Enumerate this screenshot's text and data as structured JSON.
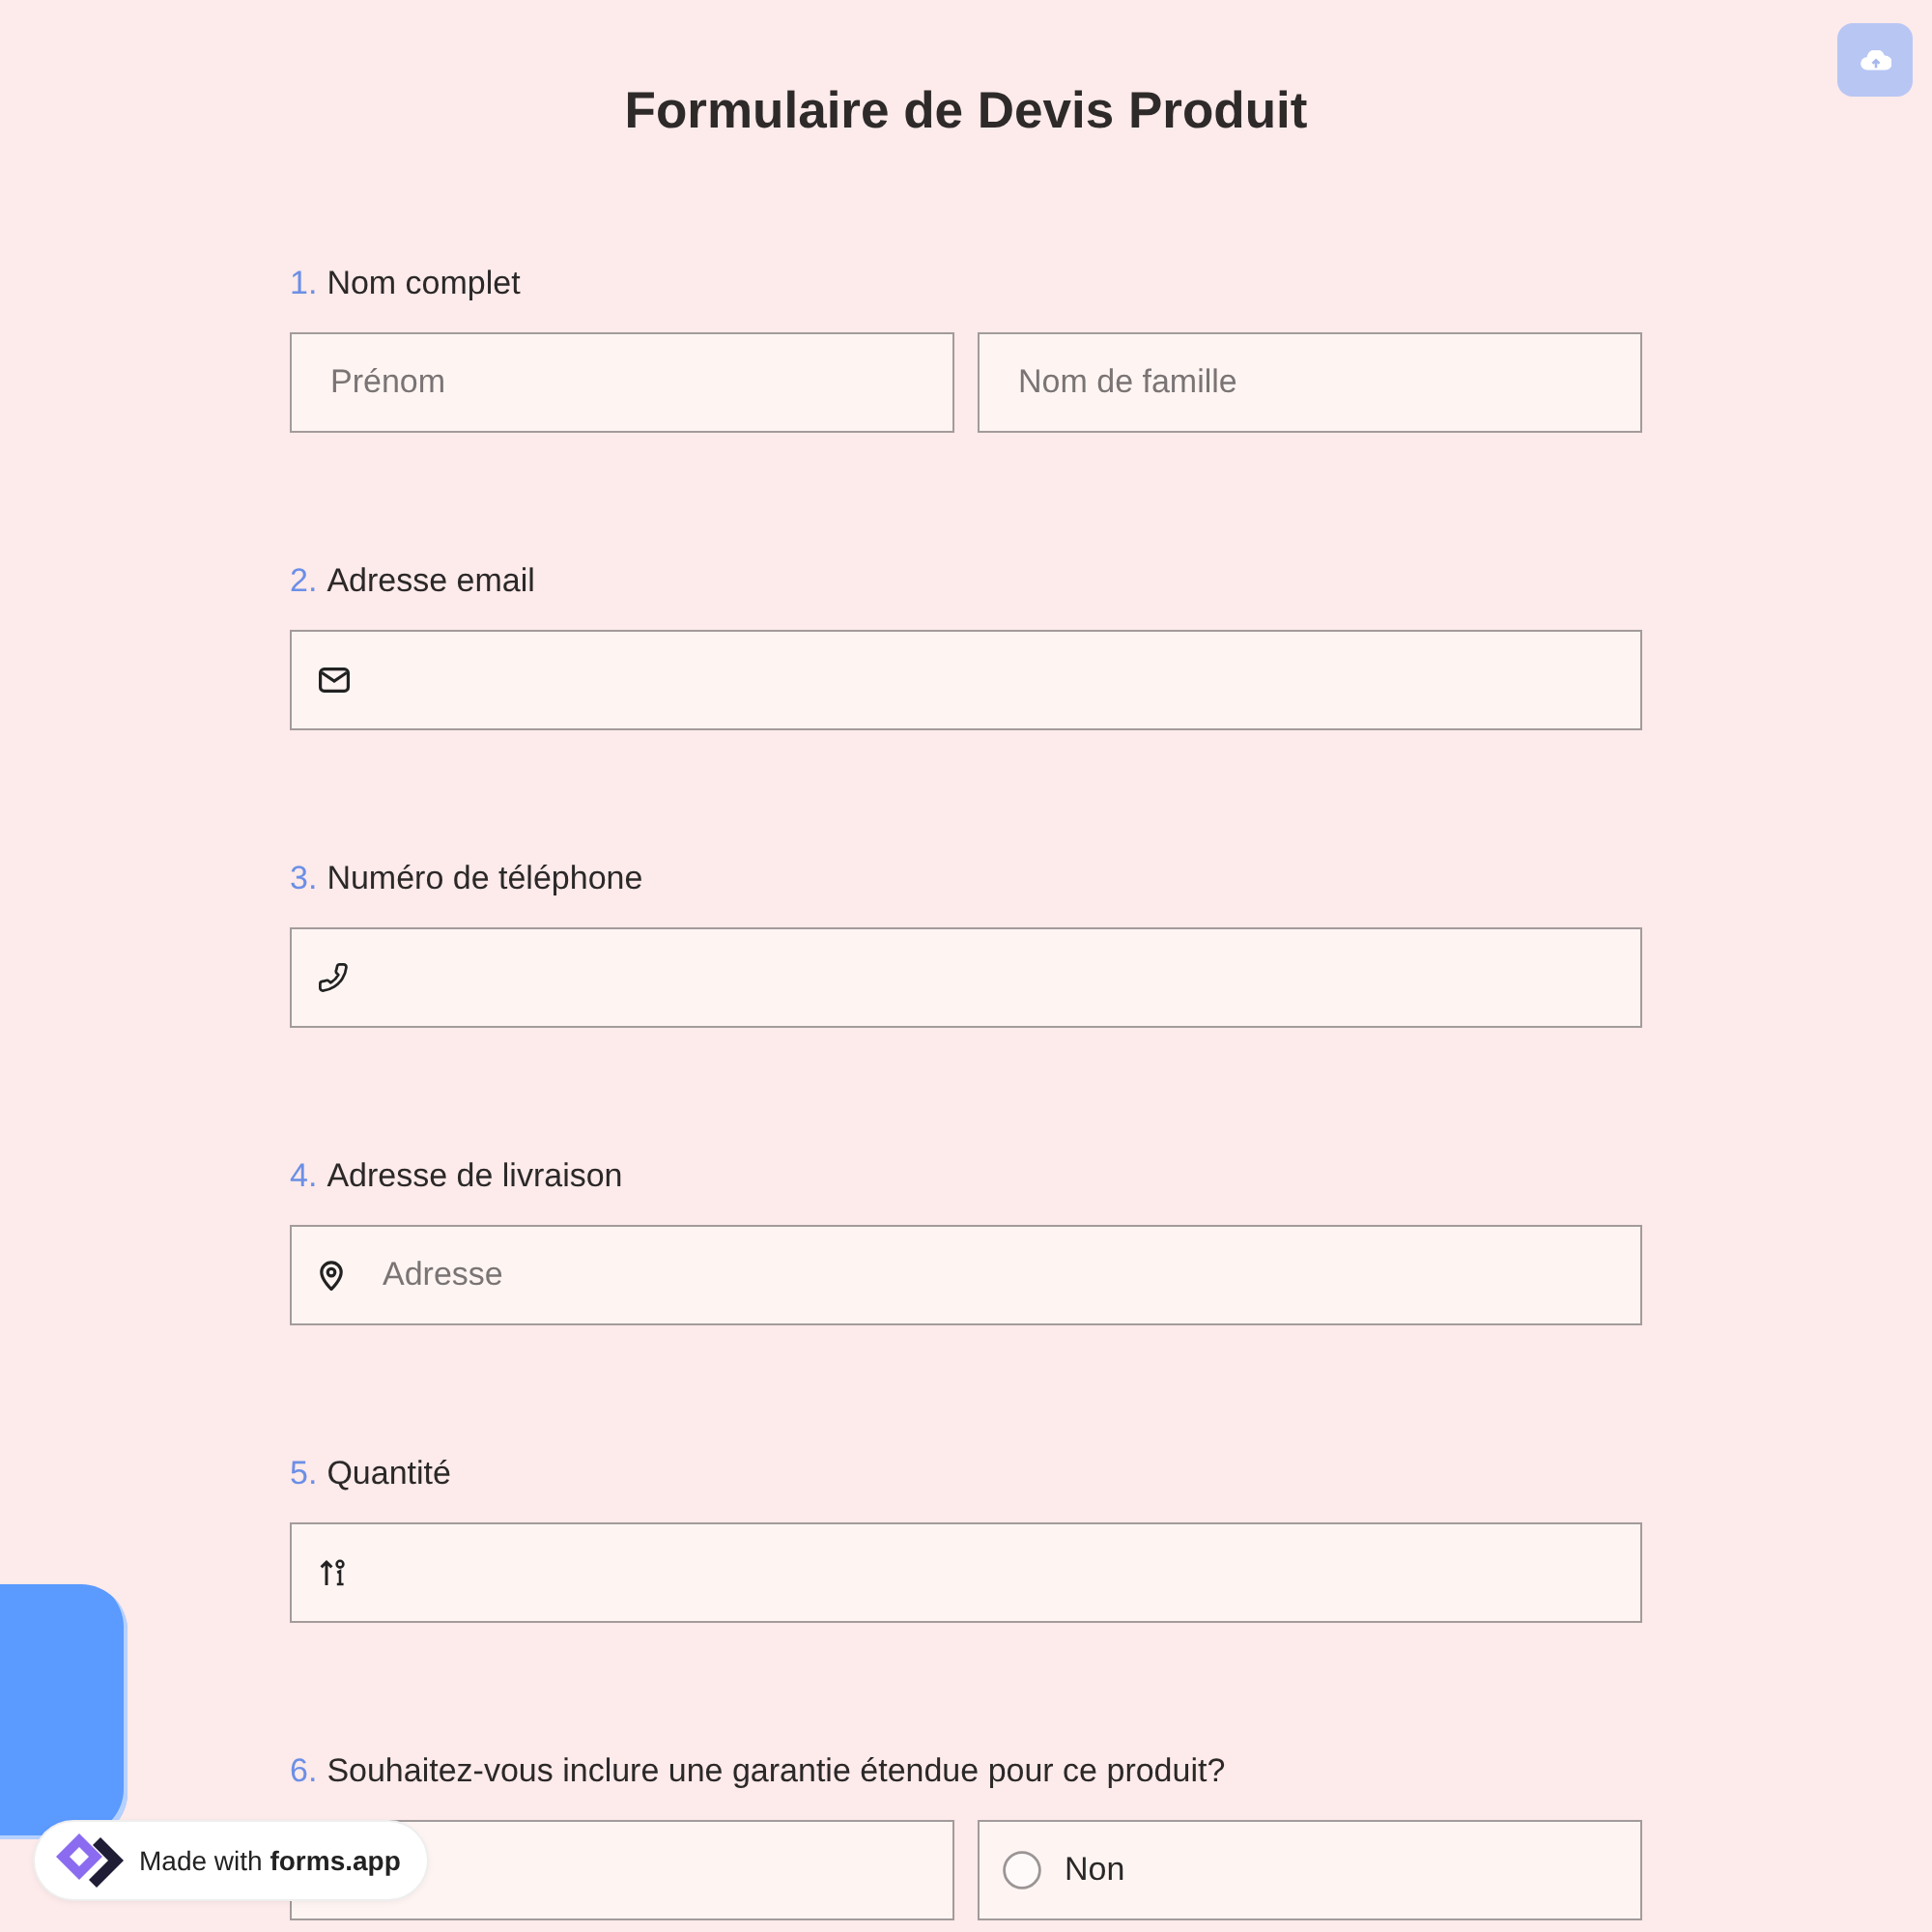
{
  "title": "Formulaire de Devis Produit",
  "questions": [
    {
      "number": "1.",
      "label": "Nom complet",
      "fields": [
        {
          "kind": "text",
          "placeholder": "Prénom"
        },
        {
          "kind": "text",
          "placeholder": "Nom de famille"
        }
      ]
    },
    {
      "number": "2.",
      "label": "Adresse email",
      "fields": [
        {
          "kind": "email"
        }
      ]
    },
    {
      "number": "3.",
      "label": "Numéro de téléphone",
      "fields": [
        {
          "kind": "phone"
        }
      ]
    },
    {
      "number": "4.",
      "label": "Adresse de livraison",
      "fields": [
        {
          "kind": "address",
          "placeholder": "Adresse"
        }
      ]
    },
    {
      "number": "5.",
      "label": "Quantité",
      "fields": [
        {
          "kind": "number"
        }
      ]
    },
    {
      "number": "6.",
      "label": "Souhaitez-vous inclure une garantie étendue pour ce produit?",
      "fields": [
        {
          "kind": "covered"
        },
        {
          "kind": "radio",
          "label": "Non",
          "selected": false
        }
      ]
    }
  ],
  "badge": {
    "text": "Made with **forms.app**"
  }
}
